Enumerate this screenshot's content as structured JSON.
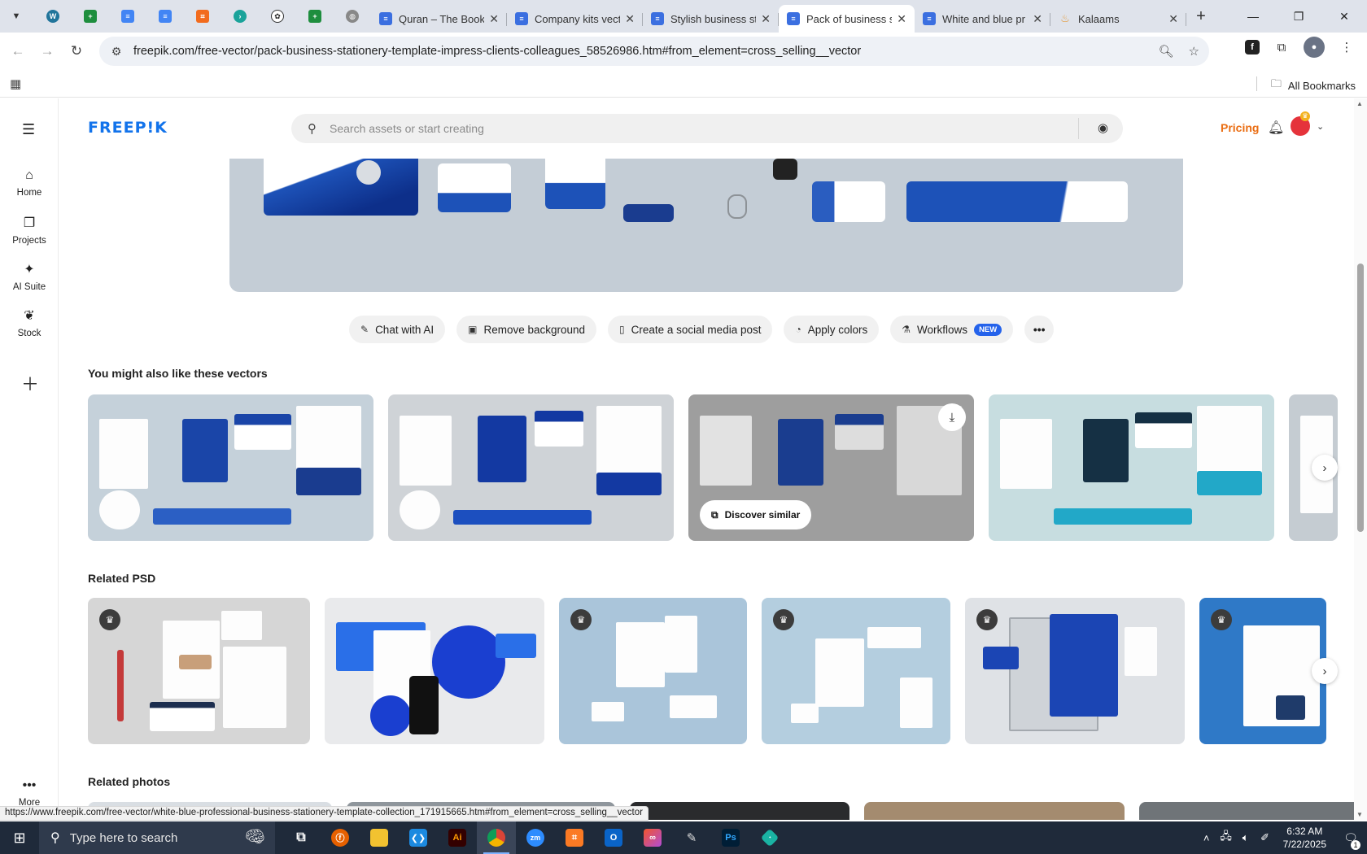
{
  "browser": {
    "tabs": [
      {
        "title": "Quran – The Book",
        "icon_color": "#3b6fe0",
        "active": false
      },
      {
        "title": "Company kits vect",
        "icon_color": "#3b6fe0",
        "active": false
      },
      {
        "title": "Stylish business st",
        "icon_color": "#3b6fe0",
        "active": false
      },
      {
        "title": "Pack of business st",
        "icon_color": "#3b6fe0",
        "active": true
      },
      {
        "title": "White and blue pr",
        "icon_color": "#3b6fe0",
        "active": false
      },
      {
        "title": "Kalaams",
        "icon_color": "#e39b3b",
        "active": false
      }
    ],
    "pinned_tabs": [
      "wordpress-icon",
      "sheets-icon",
      "docs-icon",
      "docs-icon",
      "shape-icon",
      "arrow-icon",
      "openai-icon",
      "sheets-icon",
      "globe-icon"
    ],
    "new_tab_label": "+",
    "url": "freepik.com/free-vector/pack-business-stationery-template-impress-clients-colleagues_58526986.htm#from_element=cross_selling__vector",
    "all_bookmarks_label": "All Bookmarks",
    "status_url": "https://www.freepik.com/free-vector/white-blue-professional-business-stationery-template-collection_171915665.htm#from_element=cross_selling__vector"
  },
  "freepik": {
    "logo": "FREEP!K",
    "search_placeholder": "Search assets or start creating",
    "pricing_label": "Pricing",
    "brand_color": "#1273eb",
    "rail": [
      {
        "label": "Home",
        "icon": "home-icon",
        "glyph": "⌂"
      },
      {
        "label": "Projects",
        "icon": "projects-icon",
        "glyph": "❐"
      },
      {
        "label": "AI Suite",
        "icon": "ai-suite-icon",
        "glyph": "✦"
      },
      {
        "label": "Stock",
        "icon": "stock-icon",
        "glyph": "❦"
      }
    ],
    "rail_more_label": "More",
    "actions": [
      {
        "label": "Chat with AI",
        "icon": "chat-ai-icon",
        "glyph": "✎"
      },
      {
        "label": "Remove background",
        "icon": "remove-bg-icon",
        "glyph": "▣"
      },
      {
        "label": "Create a social media post",
        "icon": "phone-icon",
        "glyph": "▯"
      },
      {
        "label": "Apply colors",
        "icon": "palette-icon",
        "glyph": "◔"
      },
      {
        "label": "Workflows",
        "icon": "workflows-icon",
        "glyph": "⚗",
        "badge": "NEW"
      }
    ],
    "sections": {
      "vectors_title": "You might also like these vectors",
      "psd_title": "Related PSD",
      "photos_title": "Related photos"
    },
    "discover_label": "Discover similar"
  },
  "taskbar": {
    "search_placeholder": "Type here to search",
    "time": "6:32 AM",
    "date": "7/22/2025",
    "notifications": "1"
  }
}
